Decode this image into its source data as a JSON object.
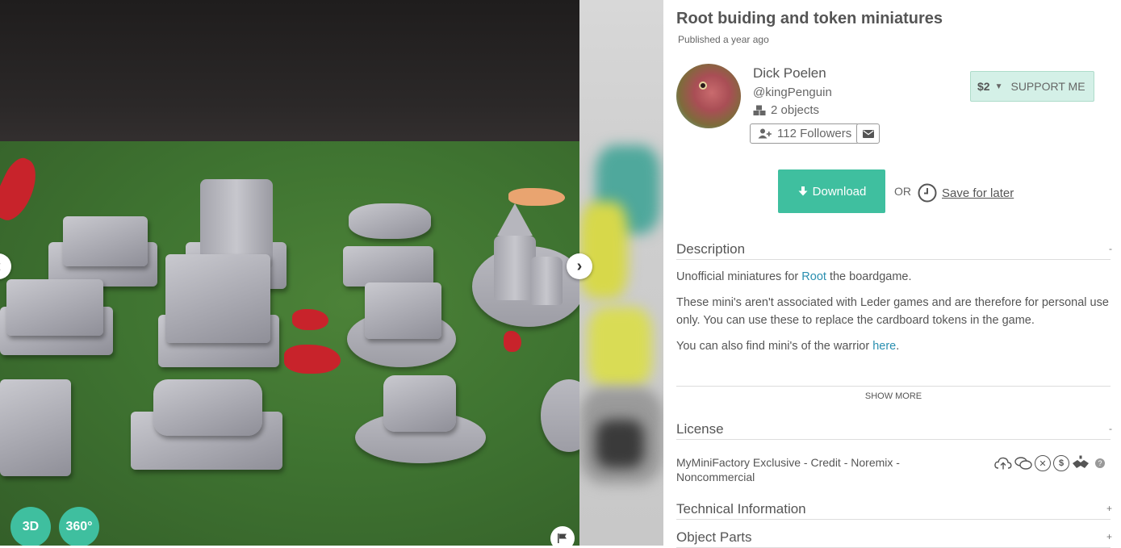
{
  "gallery": {
    "view_3d_label": "3D",
    "view_360_label": "360°",
    "prev_icon": "chevron-left-icon",
    "next_icon": "chevron-right-icon",
    "flag_icon": "flag-icon",
    "colors": {
      "accent": "#3fbf9f"
    }
  },
  "object": {
    "title": "Root buiding and token miniatures",
    "published": "Published a year ago"
  },
  "author": {
    "name": "Dick Poelen",
    "handle": "@kingPenguin",
    "objects": "2 objects",
    "followers": "112 Followers",
    "objects_icon": "cubes-icon",
    "follow_icon": "user-plus-icon",
    "mail_icon": "envelope-icon"
  },
  "support": {
    "price": "$2",
    "label": "SUPPORT ME"
  },
  "actions": {
    "download_label": "Download",
    "or_label": "OR",
    "save_label": "Save for later"
  },
  "description": {
    "heading": "Description",
    "toggle": "-",
    "p1_before": "Unofficial miniatures for ",
    "p1_link": "Root",
    "p1_after": " the boardgame.",
    "p2": "These mini's aren't associated with Leder games and are therefore for personal use only. You can use these to replace the cardboard tokens in the game.",
    "p3_before": "You can also find mini's of the warrior ",
    "p3_link": "here",
    "p3_after": ".",
    "show_more": "SHOW MORE"
  },
  "license": {
    "heading": "License",
    "toggle": "-",
    "text": "MyMiniFactory Exclusive - Credit - Noremix - Noncommercial",
    "help": "?"
  },
  "technical": {
    "heading": "Technical Information",
    "toggle": "+"
  },
  "parts": {
    "heading": "Object Parts",
    "toggle": "+"
  }
}
